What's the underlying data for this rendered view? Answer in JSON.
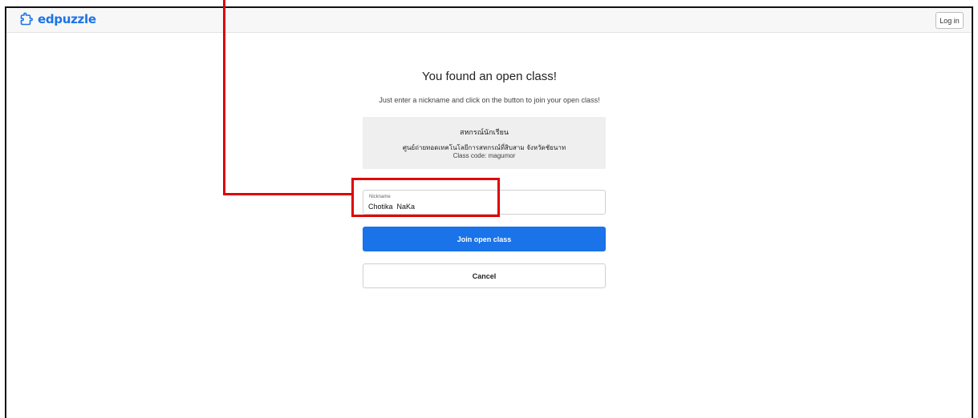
{
  "header": {
    "brand": "edpuzzle",
    "logo_icon": "puzzle-piece-icon",
    "login_label": "Log in"
  },
  "main": {
    "title": "You found an open class!",
    "subtitle": "Just enter a nickname and click on the button to join your open class!",
    "class_card": {
      "class_name": "สหกรณ์นักเรียน",
      "school_name": "ศูนย์ถ่ายทอดเทคโนโลยีการสหกรณ์ที่สิบสาม จังหวัดชัยนาท",
      "class_code": "Class code: magumor"
    },
    "nickname": {
      "label": "Nickname",
      "value": "Chotika  NaKa"
    },
    "join_label": "Join open class",
    "cancel_label": "Cancel"
  },
  "colors": {
    "brand": "#1a73e8",
    "annotation": "#e00000",
    "card_bg": "#efefef"
  }
}
